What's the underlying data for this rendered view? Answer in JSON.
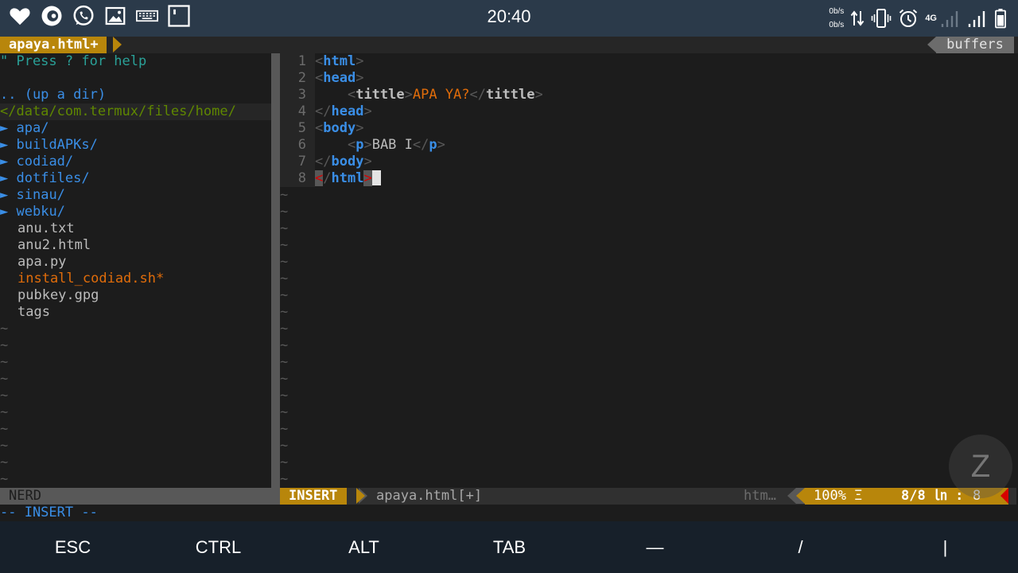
{
  "status_bar": {
    "time": "20:40",
    "net_up": "0b/s",
    "net_down": "0b/s",
    "network_type": "4G",
    "left_icons": [
      "heart-icon",
      "notification-app-icon",
      "whatsapp-icon",
      "gallery-icon",
      "keyboard-icon",
      "screen-icon"
    ],
    "right_icons": [
      "data-transfer-icon",
      "vibrate-icon",
      "alarm-icon",
      "signal-icon",
      "battery-icon"
    ]
  },
  "tabline": {
    "active_tab": "apaya.html+",
    "buffers_label": "buffers"
  },
  "nerdtree": {
    "help": "\" Press ? for help",
    "up_dir": ".. (up a dir)",
    "cwd": "</data/com.termux/files/home/",
    "dirs": [
      "apa/",
      "buildAPKs/",
      "codiad/",
      "dotfiles/",
      "sinau/",
      "webku/"
    ],
    "dir_marker": "►",
    "files": [
      "anu.txt",
      "anu2.html",
      "apa.py",
      "install_codiad.sh*",
      "pubkey.gpg",
      "tags"
    ],
    "tilde": "~",
    "status_label": "NERD"
  },
  "editor": {
    "line_numbers": [
      "1",
      "2",
      "3",
      "4",
      "5",
      "6",
      "7",
      "8"
    ],
    "tilde": "~",
    "lines": {
      "l1_open": "<",
      "l1_tag": "html",
      "l1_close": ">",
      "l2_open": "<",
      "l2_tag": "head",
      "l2_close": ">",
      "l3_indent": "    ",
      "l3_open": "<",
      "l3_tag": "tittle",
      "l3_close": ">",
      "l3_text": "APA YA?",
      "l3_end_open": "</",
      "l3_end_tag": "tittle",
      "l3_end_close": ">",
      "l4_open": "</",
      "l4_tag": "head",
      "l4_close": ">",
      "l5_open": "<",
      "l5_tag": "body",
      "l5_close": ">",
      "l6_indent": "    ",
      "l6_open": "<",
      "l6_tag": "p",
      "l6_close": ">",
      "l6_text": "BAB I",
      "l6_end_open": "</",
      "l6_end_tag": "p",
      "l6_end_close": ">",
      "l7_open": "</",
      "l7_tag": "body",
      "l7_close": ">",
      "l8_lt": "<",
      "l8_slash": "/",
      "l8_tag": "html",
      "l8_gt": ">"
    }
  },
  "statusline": {
    "mode": "INSERT",
    "filename": "apaya.html[+]",
    "filetype": "htm…",
    "percent": "100% Ξ",
    "line_col": "8/8 ㏑ :",
    "col": "8"
  },
  "cmdline": "-- INSERT --",
  "extra_keys": [
    "ESC",
    "CTRL",
    "ALT",
    "TAB",
    "—",
    "/",
    "|"
  ],
  "overlay_letter": "Z",
  "colors": {
    "accent": "#b8860b",
    "tag_blue": "#3a8ee6",
    "string_orange": "#e06c0a",
    "help_teal": "#2aa198",
    "cwd_green": "#5f8700",
    "error_red": "#d70000"
  }
}
